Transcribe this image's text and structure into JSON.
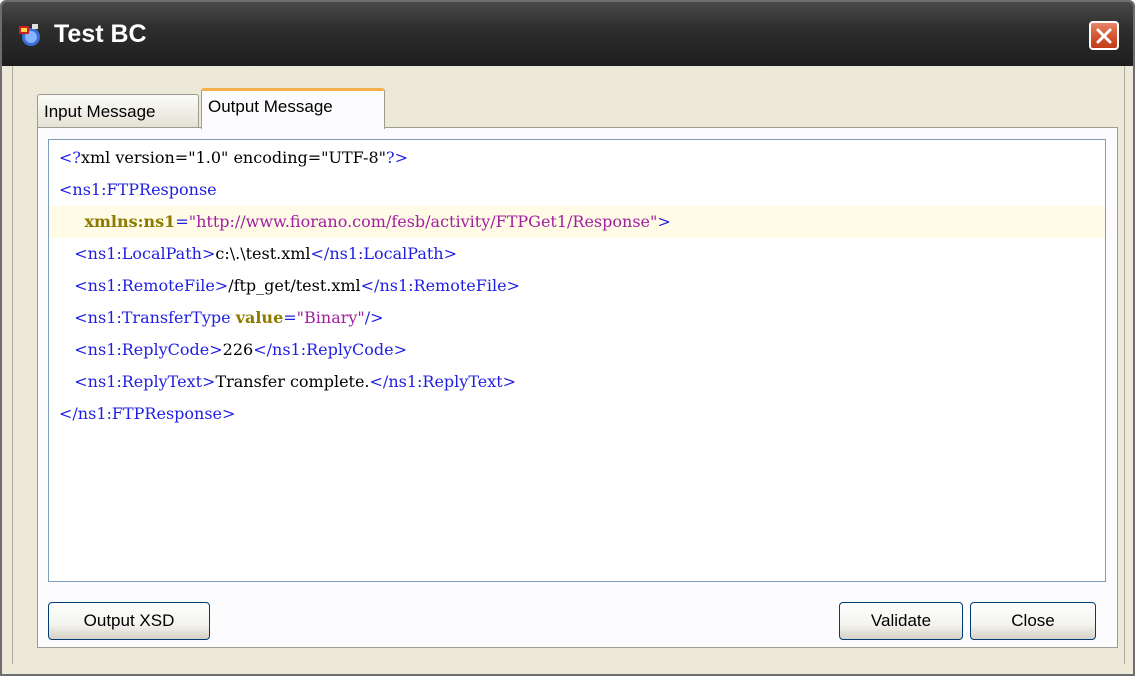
{
  "window": {
    "title": "Test BC"
  },
  "tabs": [
    {
      "label": "Input Message",
      "selected": false
    },
    {
      "label": "Output Message",
      "selected": true
    }
  ],
  "editor": {
    "lines": [
      [
        {
          "text": "<?",
          "kind": "tag"
        },
        {
          "text": "xml version=\"1.0\" encoding=\"UTF-8\"",
          "kind": "text"
        },
        {
          "text": "?>",
          "kind": "tag"
        }
      ],
      [
        {
          "text": "<ns1:FTPResponse",
          "kind": "tag"
        }
      ],
      [
        {
          "text": "     ",
          "kind": "text"
        },
        {
          "text": "xmlns:ns1",
          "kind": "attr"
        },
        {
          "text": "=",
          "kind": "tag"
        },
        {
          "text": "\"http://www.fiorano.com/fesb/activity/FTPGet1/Response\"",
          "kind": "value"
        },
        {
          "text": ">",
          "kind": "tag"
        }
      ],
      [
        {
          "text": "   ",
          "kind": "text"
        },
        {
          "text": "<ns1:LocalPath>",
          "kind": "tag"
        },
        {
          "text": "c:\\.\\test.xml",
          "kind": "text"
        },
        {
          "text": "</ns1:LocalPath>",
          "kind": "tag"
        }
      ],
      [
        {
          "text": "   ",
          "kind": "text"
        },
        {
          "text": "<ns1:RemoteFile>",
          "kind": "tag"
        },
        {
          "text": "/ftp_get/test.xml",
          "kind": "text"
        },
        {
          "text": "</ns1:RemoteFile>",
          "kind": "tag"
        }
      ],
      [
        {
          "text": "   ",
          "kind": "text"
        },
        {
          "text": "<ns1:TransferType ",
          "kind": "tag"
        },
        {
          "text": "value",
          "kind": "attr"
        },
        {
          "text": "=",
          "kind": "tag"
        },
        {
          "text": "\"Binary\"",
          "kind": "value"
        },
        {
          "text": "/>",
          "kind": "tag"
        }
      ],
      [
        {
          "text": "   ",
          "kind": "text"
        },
        {
          "text": "<ns1:ReplyCode>",
          "kind": "tag"
        },
        {
          "text": "226",
          "kind": "text"
        },
        {
          "text": "</ns1:ReplyCode>",
          "kind": "tag"
        }
      ],
      [
        {
          "text": "   ",
          "kind": "text"
        },
        {
          "text": "<ns1:ReplyText>",
          "kind": "tag"
        },
        {
          "text": "Transfer complete.",
          "kind": "text"
        },
        {
          "text": "</ns1:ReplyText>",
          "kind": "tag"
        }
      ],
      [
        {
          "text": "</ns1:FTPResponse>",
          "kind": "tag"
        }
      ]
    ],
    "highlighted_line": 2
  },
  "buttons": {
    "output_xsd": "Output XSD",
    "validate": "Validate",
    "close": "Close"
  },
  "colors": {
    "tag": "#1f1fe0",
    "attr": "#8e7a00",
    "value": "#a020a0",
    "tab_accent": "#f7b04a",
    "close_button": "#d3532f"
  },
  "icons": {
    "app": "app-icon",
    "close": "close-icon"
  }
}
